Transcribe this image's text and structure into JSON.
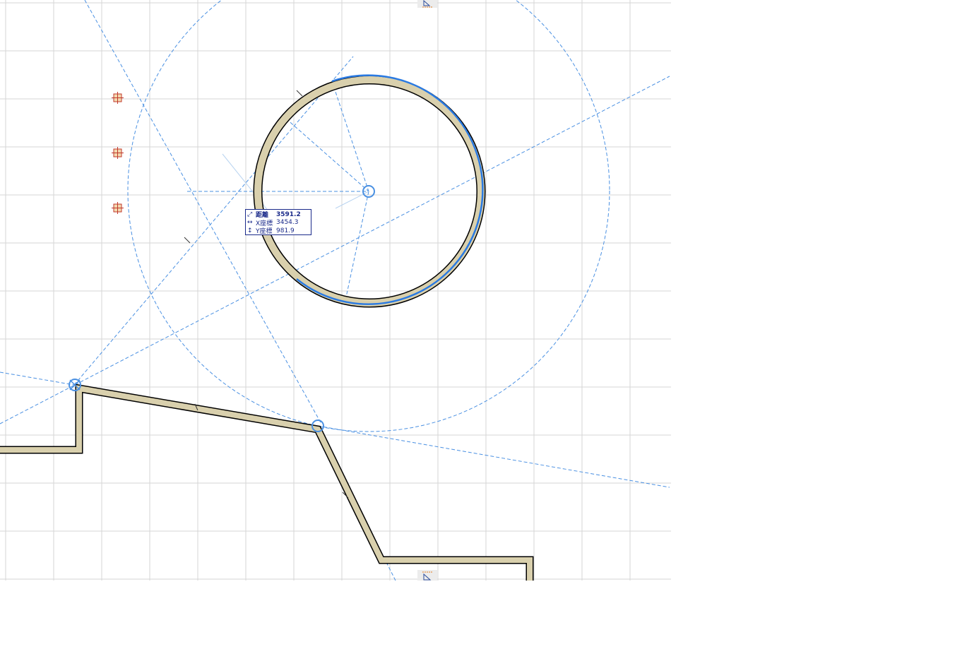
{
  "canvas": {
    "background": "#ffffff",
    "grid_color": "#d6d6d6",
    "guide_color": "#4a90e2",
    "wall_fill": "#d9d0ad",
    "wall_stroke": "#000000",
    "hotspot_color": "#c0392b",
    "selection_color": "#2a7ae2"
  },
  "tracker": {
    "rows": [
      {
        "icon": "⤢",
        "label": "距離",
        "value": "3591.2",
        "bold": true
      },
      {
        "icon": "↔",
        "label": "X座標",
        "value": "3454.3",
        "bold": false
      },
      {
        "icon": "↕",
        "label": "Y座標",
        "value": "981.9",
        "bold": false
      }
    ]
  },
  "icons": {
    "top_marker": "section-marker-icon",
    "bottom_marker": "section-marker-icon",
    "hotspots": [
      "hotspot-icon",
      "hotspot-icon",
      "hotspot-icon"
    ]
  }
}
